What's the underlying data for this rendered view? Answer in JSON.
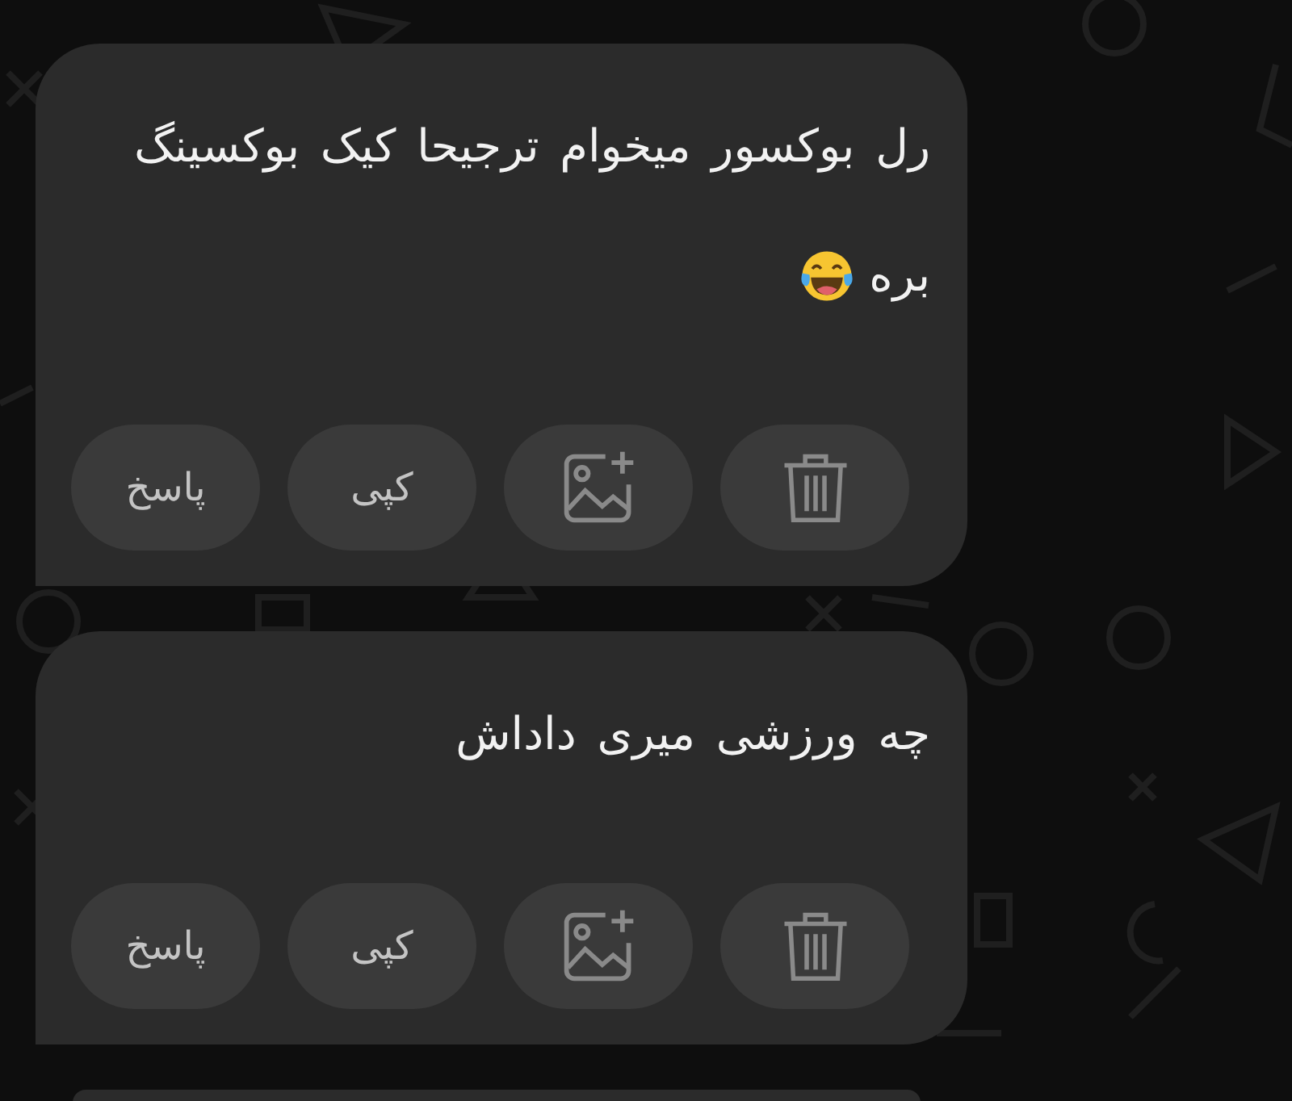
{
  "messages": [
    {
      "kind": "full",
      "lines": [
        "رل بوکسور  میخوام ترجیحا کیک بوکسینگ",
        "بره"
      ],
      "laughing_emoji": true,
      "actions": [
        {
          "kind": "delete"
        },
        {
          "kind": "add-image"
        },
        {
          "kind": "text",
          "label": "کپی"
        },
        {
          "kind": "text",
          "label": "پاسخ"
        }
      ]
    },
    {
      "kind": "full",
      "lines": [
        "چه ورزشی میری داداش"
      ],
      "actions": [
        {
          "kind": "delete"
        },
        {
          "kind": "add-image"
        },
        {
          "kind": "text",
          "label": "کپی"
        },
        {
          "kind": "text",
          "label": "پاسخ"
        }
      ]
    },
    {
      "kind": "cut-off"
    }
  ]
}
